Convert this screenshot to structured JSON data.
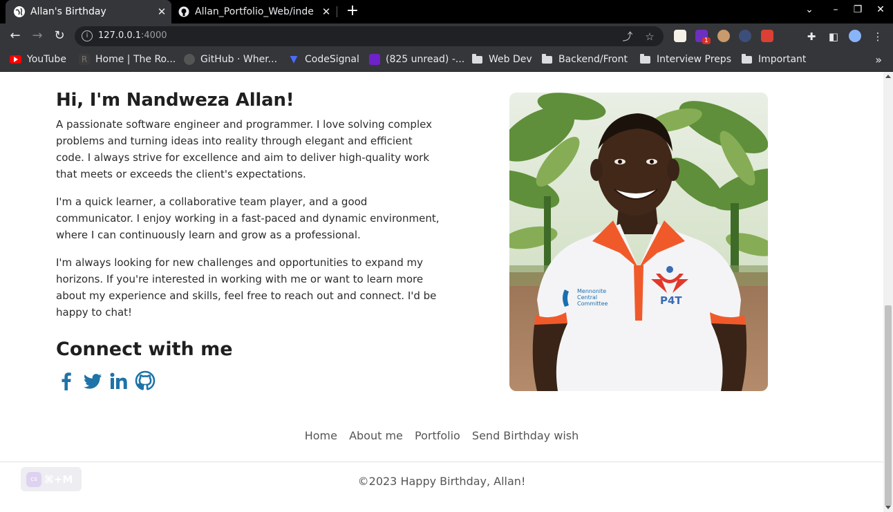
{
  "browser": {
    "tabs": [
      {
        "title": "Allan's Birthday",
        "active": true
      },
      {
        "title": "Allan_Portfolio_Web/inde",
        "active": false
      }
    ],
    "url_host": "127.0.0.1",
    "url_port": ":4000",
    "bookmarks": [
      {
        "label": "YouTube",
        "icon": "youtube-icon"
      },
      {
        "label": "Home | The Ro...",
        "icon": "site-icon"
      },
      {
        "label": "GitHub · Wher...",
        "icon": "github-icon"
      },
      {
        "label": "CodeSignal",
        "icon": "codesignal-icon"
      },
      {
        "label": "(825 unread) -...",
        "icon": "mail-icon"
      },
      {
        "label": "Web Dev",
        "icon": "folder-icon"
      },
      {
        "label": "Backend/Front",
        "icon": "folder-icon"
      },
      {
        "label": "Interview Preps",
        "icon": "folder-icon"
      },
      {
        "label": "Important",
        "icon": "folder-icon"
      }
    ],
    "extension_badge": "1"
  },
  "about": {
    "heading": "Hi, I'm Nandweza Allan!",
    "paragraphs": [
      "A passionate software engineer and programmer. I love solving complex problems and turning ideas into reality through elegant and efficient code. I always strive for excellence and aim to deliver high-quality work that meets or exceeds the client's expectations.",
      "I'm a quick learner, a collaborative team player, and a good communicator. I enjoy working in a fast-paced and dynamic environment, where I can continuously learn and grow as a professional.",
      "I'm always looking for new challenges and opportunities to expand my horizons. If you're interested in working with me or want to learn more about my experience and skills, feel free to reach out and connect. I'd be happy to chat!"
    ]
  },
  "connect": {
    "heading": "Connect with me",
    "icon_color": "#1e73a8",
    "links": [
      "facebook-icon",
      "twitter-icon",
      "linkedin-icon",
      "github-icon"
    ]
  },
  "photo": {
    "shirt_text_1": "Mennonite",
    "shirt_text_2": "Central",
    "shirt_text_3": "Committee",
    "shirt_logo_text": "P4T"
  },
  "footer": {
    "nav": [
      "Home",
      "About me",
      "Portfolio",
      "Send Birthday wish"
    ],
    "copyright": "©2023 Happy Birthday, Allan!"
  },
  "overlay": {
    "logo": "cs",
    "shortcut": "⌘+M"
  }
}
